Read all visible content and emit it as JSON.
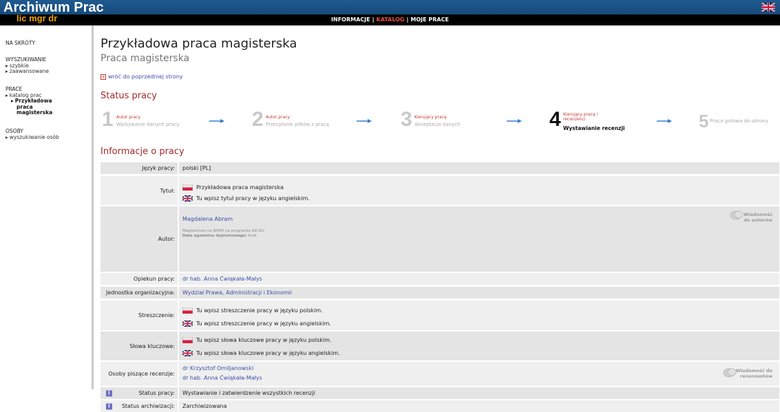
{
  "header": {
    "logo": "Archiwum Prac",
    "logo_sub": "lic mgr dr",
    "nav": [
      {
        "label": "INFORMACJE",
        "active": false
      },
      {
        "label": "KATALOG",
        "active": true
      },
      {
        "label": "MOJE PRACE",
        "active": false
      }
    ],
    "language_icon": "uk-flag-icon"
  },
  "sidebar": {
    "shortcuts": "NA SKRÓTY",
    "search_head": "WYSZUKIWANIE",
    "search_items": [
      "szybkie",
      "zaawansowane"
    ],
    "works_head": "PRACE",
    "works_item": "katalog prac",
    "works_sub": [
      "Przykładowa",
      "praca",
      "magisterska"
    ],
    "people_head": "OSOBY",
    "people_item": "wyszukiwanie osób"
  },
  "main": {
    "title": "Przykładowa praca magisterska",
    "subtitle": "Praca magisterska",
    "back_link": "wróć do poprzedniej strony",
    "status_heading": "Status pracy",
    "info_heading": "Informacje o pracy",
    "steps": [
      {
        "num": "1",
        "label": "Autor pracy",
        "desc": "Wpisywanie danych pracy",
        "active": false
      },
      {
        "num": "2",
        "label": "Autor pracy",
        "desc": "Przesyłanie plików z pracą",
        "active": false
      },
      {
        "num": "3",
        "label": "Kierujący pracą",
        "desc": "Akceptacja danych",
        "active": false
      },
      {
        "num": "4",
        "label_1": "Kierujący pracą i",
        "label_2": "recenzenci",
        "desc": "Wystawianie recenzji",
        "active": true
      },
      {
        "num": "5",
        "desc": "Praca gotowa do obrony",
        "active": false
      }
    ],
    "info": {
      "lang_label": "Język pracy:",
      "lang_value": "polski [PL]",
      "title_label": "Tytuł:",
      "title_pl": "Przykładowa praca magisterska",
      "title_en": "Tu wpisz tytuł pracy w języku angielskim.",
      "author_label": "Autor:",
      "author_name": "Magdalena Abram",
      "author_detail_1": "Magisterium na WPAE na programie AD-DU",
      "author_detail_2_label": "Data egzaminu dyplomowego:",
      "author_detail_2_value": "brak",
      "author_msg_1": "Wiadomość",
      "author_msg_2": "do autorów",
      "supervisor_label": "Opiekun pracy:",
      "supervisor_value": "dr hab. Anna Ćwiąkała-Małys",
      "unit_label": "Jednostka organizacyjna:",
      "unit_value": "Wydział Prawa, Administracji i Ekonomii",
      "abstract_label": "Streszczenie:",
      "abstract_pl": "Tu wpisz streszczenie pracy w języku polskim.",
      "abstract_en": "Tu wpisz streszczenie pracy w języku angielskim.",
      "keywords_label": "Słowa kluczowe:",
      "keywords_pl": "Tu wpisz słowa kluczowe pracy w języku polskim.",
      "keywords_en": "Tu wpisz słowa kluczowe pracy w języku angielskim.",
      "reviewers_label": "Osoby piszące recenzje:",
      "reviewer_1": "dr Krzysztof Omiljanowski",
      "reviewer_2": "dr hab. Anna Ćwiąkała-Małys",
      "reviewers_msg_1": "Wiadomość do",
      "reviewers_msg_2": "recenzentów",
      "status_label": "Status pracy:",
      "status_value": "Wystawianie i zatwierdzenie wszystkich recenzji",
      "archive_label": "Status archiwizacji:",
      "archive_value": "Zarchiwizowana",
      "info_icon_glyph": "i"
    }
  },
  "colors": {
    "header_blue": "#1f5a8f",
    "accent_red": "#a02a2a",
    "link_blue": "#3a4fa8",
    "logo_orange": "#f0a000"
  }
}
